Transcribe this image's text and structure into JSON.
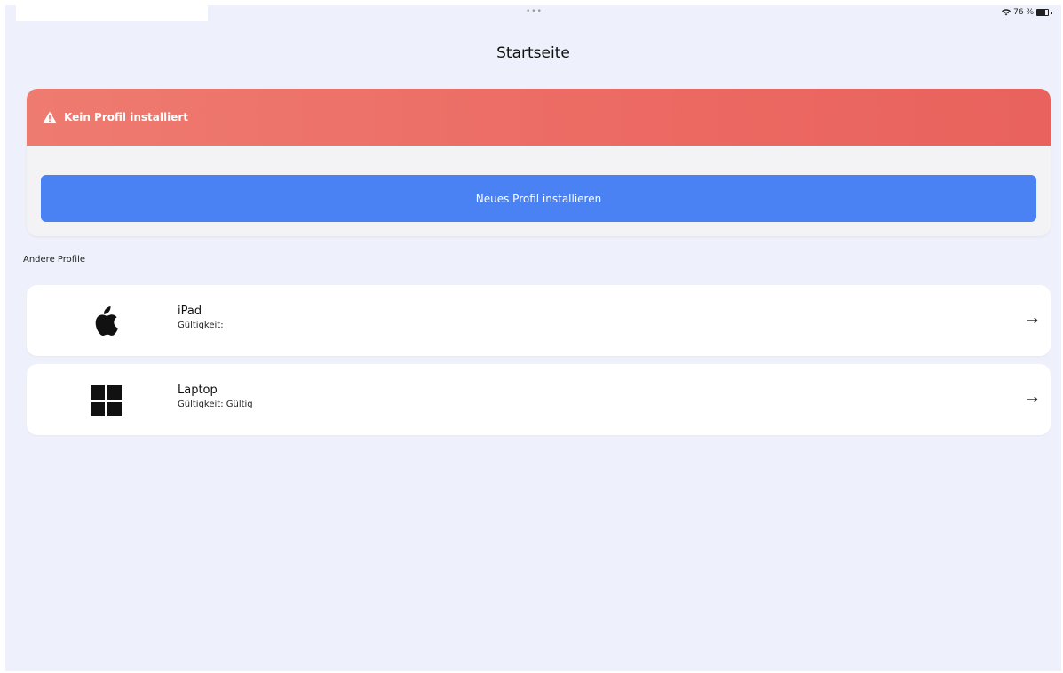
{
  "status_bar": {
    "dots": "•••",
    "battery_text": "76 %",
    "battery_level": 0.76
  },
  "header": {
    "title": "Startseite"
  },
  "alert": {
    "message": "Kein Profil installiert",
    "button_label": "Neues Profil installieren",
    "colors": {
      "header": "#ec6a63",
      "button": "#4a82f4"
    }
  },
  "section": {
    "label": "Andere Profile"
  },
  "profiles": [
    {
      "name": "iPad",
      "validity": "Gültigkeit:",
      "icon": "apple-icon"
    },
    {
      "name": "Laptop",
      "validity": "Gültigkeit: Gültig",
      "icon": "windows-icon"
    }
  ]
}
